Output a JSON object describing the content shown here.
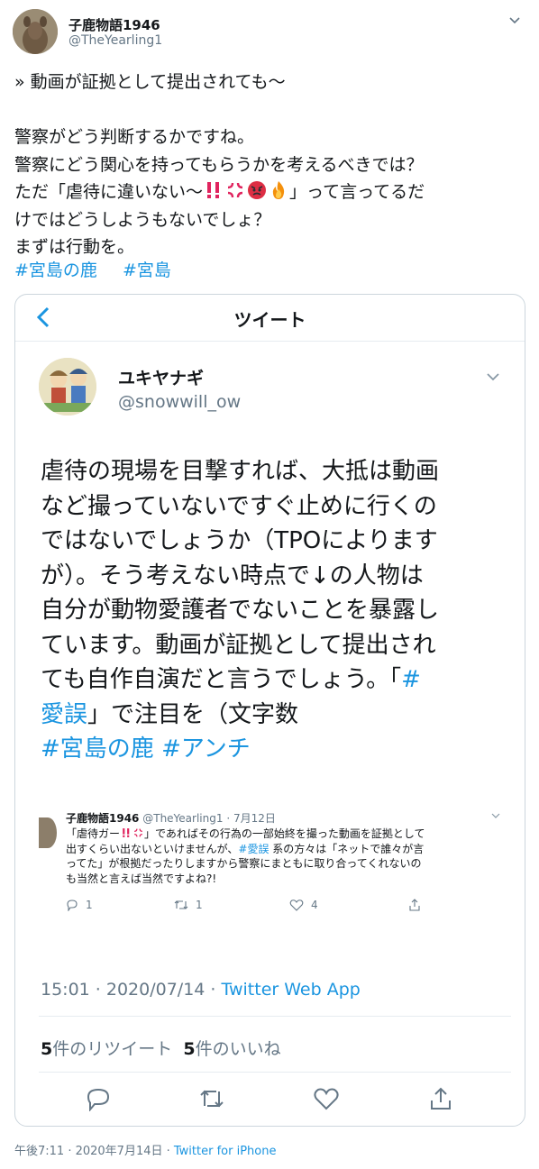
{
  "tweet": {
    "author_name": "子鹿物語1946",
    "author_handle": "@TheYearling1",
    "line1": "» 動画が証拠として提出されても〜",
    "line2": "警察がどう判断するかですね。",
    "line3": "警察にどう関心を持ってもらうかを考えるべきでは？",
    "line4_pre": "ただ「虐待に違いない〜",
    "line4_post": "」って言ってるだ",
    "line5": "けではどうしようもないでしょ？",
    "line6": "まずは行動を。",
    "hashtags": [
      "#宮島の鹿",
      "#宮島"
    ],
    "footer_time": "午後7:11 · 2020年7月14日 · ",
    "footer_source": "Twitter for iPhone"
  },
  "card": {
    "title": "ツイート",
    "author_name": "ユキヤナギ",
    "author_handle": "@snowwill_ow",
    "text_lines": [
      "虐待の現場を目撃すれば、大抵は動画",
      "など撮っていないですぐ止めに行くの",
      "ではないでしょうか（TPOによります",
      "が）。そう考えない時点で↓の人物は",
      "自分が動物愛護者でないことを暴露し",
      "ています。動画が証拠として提出され"
    ],
    "line7_pre": "ても自作自演だと言うでしょう。「",
    "line7_hash": "#",
    "line8_hash": "愛誤",
    "line8_post": "」で注目を（文字数",
    "hashtags": [
      "#宮島の鹿",
      "#アンチ"
    ],
    "quote": {
      "author_name": "子鹿物語1946",
      "author_handle": "@TheYearling1",
      "date": "· 7月12日",
      "text_pre": "「虐待ガー",
      "text_mid": "」であればその行為の一部始終を撮った動画を証拠として\n出すくらい出ないといけませんが、",
      "hash": "#愛誤",
      "text_post": " 系の方々は「ネットで誰々が言\nってた」が根拠だったりしますから警察にまともに取り合ってくれないの\nも当然と言えば当然ですよね?!",
      "reply_count": "1",
      "retweet_count": "1",
      "like_count": "4"
    },
    "timestamp": "15:01 · 2020/07/14 · ",
    "source": "Twitter Web App",
    "retweets_num": "5",
    "retweets_label": "件のリツイート",
    "likes_num": "5",
    "likes_label": "件のいいね"
  },
  "colors": {
    "link": "#1b95e0",
    "text": "#14171a",
    "muted": "#657786",
    "border": "#ccd6dd"
  },
  "icons": [
    "chevron-down-icon",
    "back-arrow-icon",
    "reply-icon",
    "retweet-icon",
    "like-icon",
    "share-icon",
    "double-exclamation-icon",
    "anger-icon",
    "angry-face-icon",
    "fire-icon"
  ]
}
